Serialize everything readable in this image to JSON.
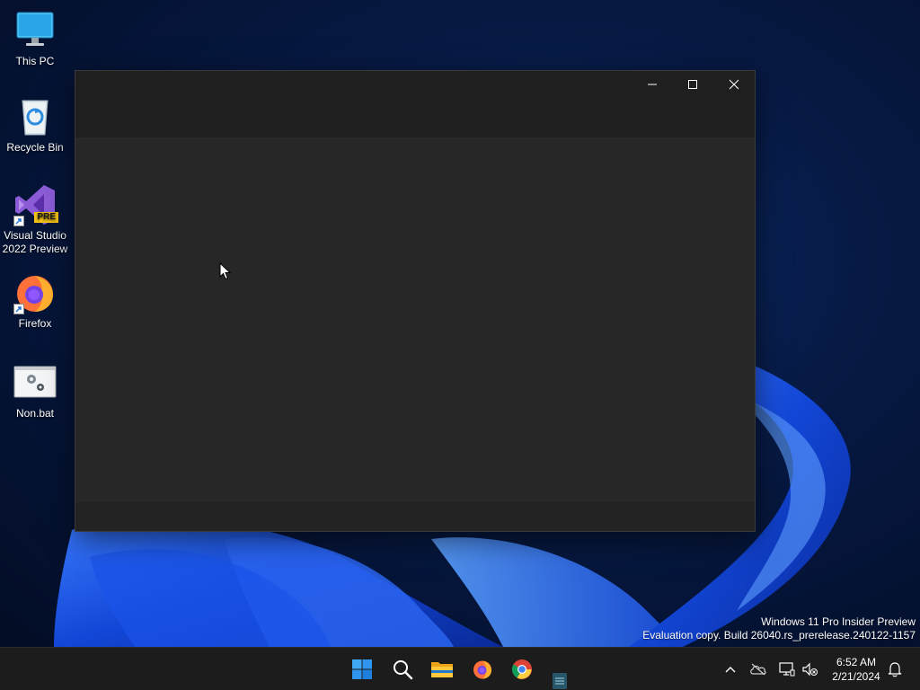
{
  "desktop": {
    "icons": [
      {
        "label": "This PC",
        "icon": "monitor-icon"
      },
      {
        "label": "Recycle Bin",
        "icon": "recycle-bin-icon"
      },
      {
        "label": "Visual Studio 2022 Preview",
        "icon": "visual-studio-icon",
        "badge": "PRE"
      },
      {
        "label": "Firefox",
        "icon": "firefox-icon"
      },
      {
        "label": "Non.bat",
        "icon": "batch-file-icon"
      }
    ]
  },
  "window": {
    "title": "",
    "buttons": {
      "minimize": "minimize-icon",
      "maximize": "maximize-icon",
      "close": "close-icon"
    }
  },
  "watermark": {
    "line1": "Windows 11 Pro Insider Preview",
    "line2": "Evaluation copy. Build 26040.rs_prerelease.240122-1157"
  },
  "taskbar": {
    "apps": [
      "start-icon",
      "search-icon",
      "file-explorer-icon",
      "firefox-icon",
      "chrome-icon",
      "notepad-icon"
    ],
    "tray": [
      "chevron-up-icon",
      "onedrive-icon",
      "network-icon",
      "volume-muted-icon",
      "notification-icon"
    ],
    "clock": {
      "time": "6:52 AM",
      "date": "2/21/2024"
    }
  },
  "colors": {
    "window_bg": "#202020",
    "content_bg": "#272727",
    "taskbar_bg": "#1c1c1c",
    "accent": "#0078d4"
  }
}
